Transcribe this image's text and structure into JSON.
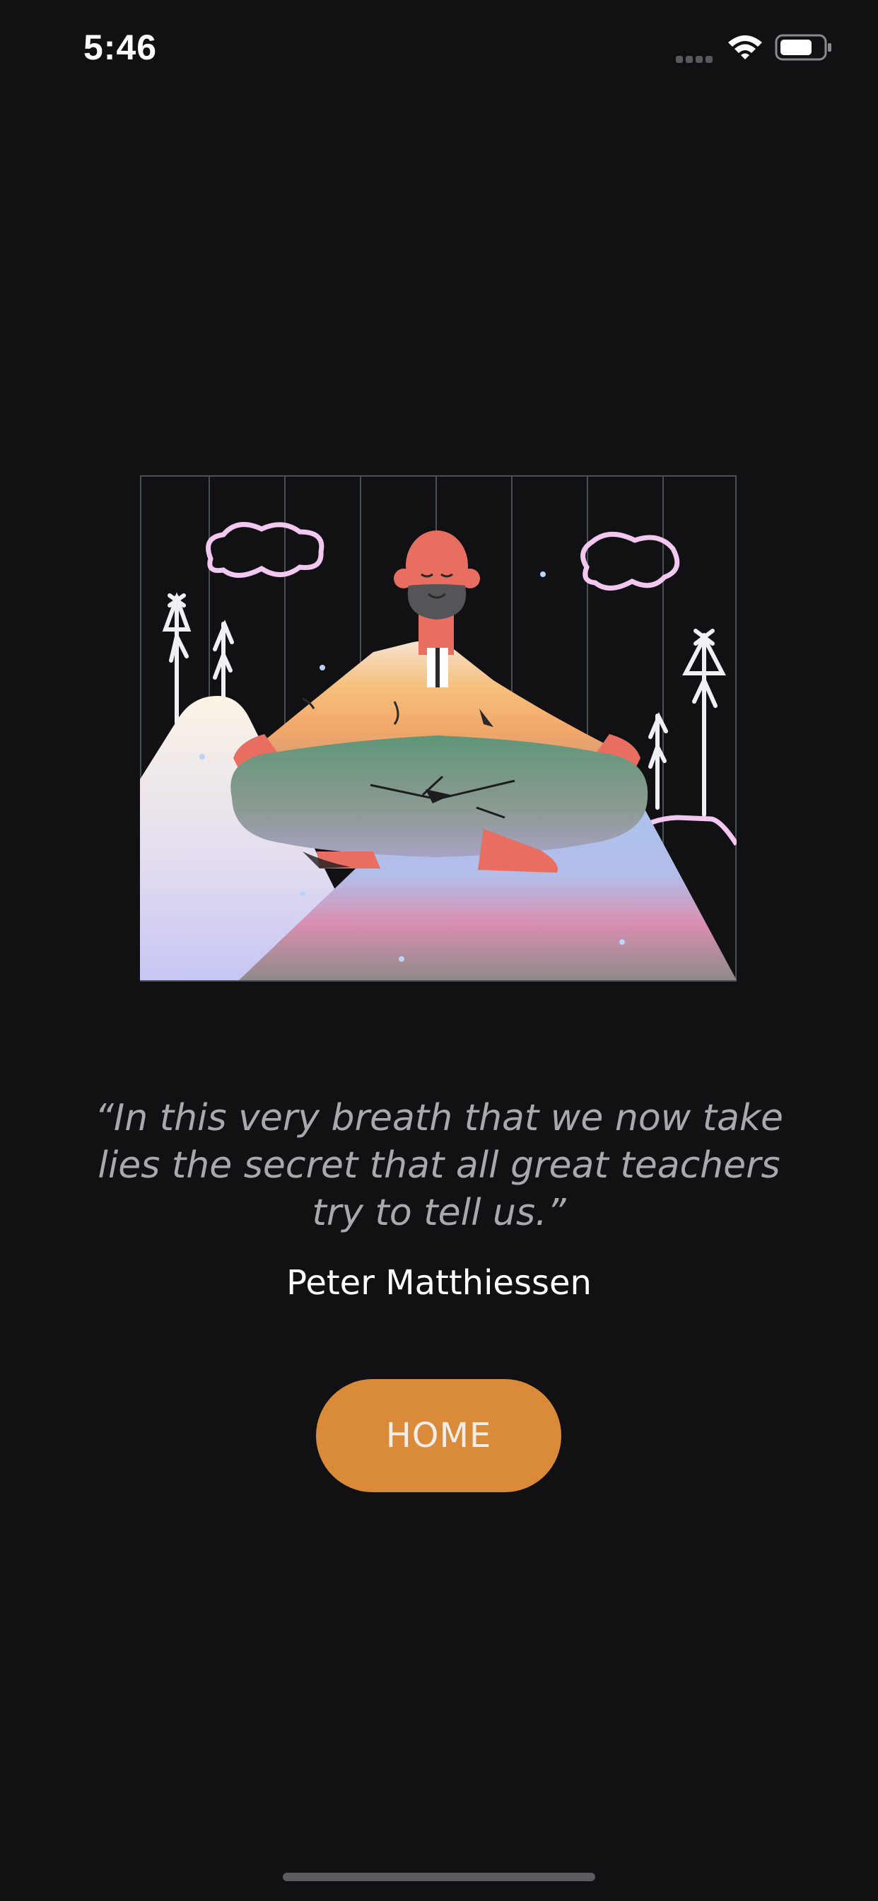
{
  "status_bar": {
    "time": "5:46"
  },
  "illustration": {
    "icon": "meditating-person-illustration"
  },
  "quote": {
    "text": "“In this very breath that we now take lies the secret that all great teachers try to tell us.”",
    "author": "Peter Matthiessen"
  },
  "actions": {
    "home_label": "HOME"
  },
  "colors": {
    "background": "#111114",
    "accent": "#d98b3a",
    "quote_text": "#a9a9ad"
  }
}
